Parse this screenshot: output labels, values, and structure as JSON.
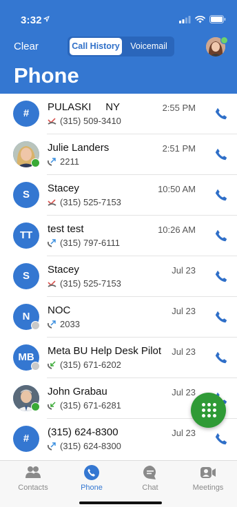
{
  "status_bar": {
    "time": "3:32"
  },
  "header": {
    "clear_label": "Clear",
    "tabs": [
      {
        "label": "Call History",
        "selected": true
      },
      {
        "label": "Voicemail",
        "selected": false
      }
    ],
    "title": "Phone",
    "header_color": "#3477d1"
  },
  "calls": [
    {
      "avatar_text": "#",
      "name": "PULASKI     NY",
      "direction": "missed",
      "number": "(315) 509-3410",
      "time": "2:55 PM",
      "presence": "none"
    },
    {
      "avatar_text": "",
      "avatar_photo": true,
      "name": "Julie Landers",
      "direction": "outgoing",
      "number": "2211",
      "time": "2:51 PM",
      "presence": "online"
    },
    {
      "avatar_text": "S",
      "name": "Stacey",
      "direction": "missed",
      "number": "(315) 525-7153",
      "time": "10:50 AM",
      "presence": "none"
    },
    {
      "avatar_text": "TT",
      "name": "test test",
      "direction": "outgoing",
      "number": "(315) 797-6111",
      "time": "10:26 AM",
      "presence": "none"
    },
    {
      "avatar_text": "S",
      "name": "Stacey",
      "direction": "missed",
      "number": "(315) 525-7153",
      "time": "Jul 23",
      "presence": "none"
    },
    {
      "avatar_text": "N",
      "name": "NOC",
      "direction": "outgoing",
      "number": "2033",
      "time": "Jul 23",
      "presence": "offline"
    },
    {
      "avatar_text": "MB",
      "name": "Meta BU Help Desk Pilot",
      "direction": "incoming",
      "number": "(315) 671-6202",
      "time": "Jul 23",
      "presence": "offline"
    },
    {
      "avatar_text": "",
      "avatar_photo": true,
      "name": "John Grabau",
      "direction": "incoming",
      "number": "(315) 671-6281",
      "time": "Jul 23",
      "presence": "online"
    },
    {
      "avatar_text": "#",
      "name": "(315) 624-8300",
      "direction": "outgoing",
      "number": "(315) 624-8300",
      "time": "Jul 23",
      "presence": "none"
    }
  ],
  "tabbar": [
    {
      "label": "Contacts",
      "icon": "contacts-icon",
      "active": false
    },
    {
      "label": "Phone",
      "icon": "phone-icon",
      "active": true
    },
    {
      "label": "Chat",
      "icon": "chat-icon",
      "active": false
    },
    {
      "label": "Meetings",
      "icon": "video-icon",
      "active": false
    }
  ],
  "colors": {
    "accent": "#3477d1",
    "fab": "#2f9a36",
    "missed": "#d9534f",
    "outgoing": "#3a8fe0",
    "incoming": "#3aaa36"
  }
}
